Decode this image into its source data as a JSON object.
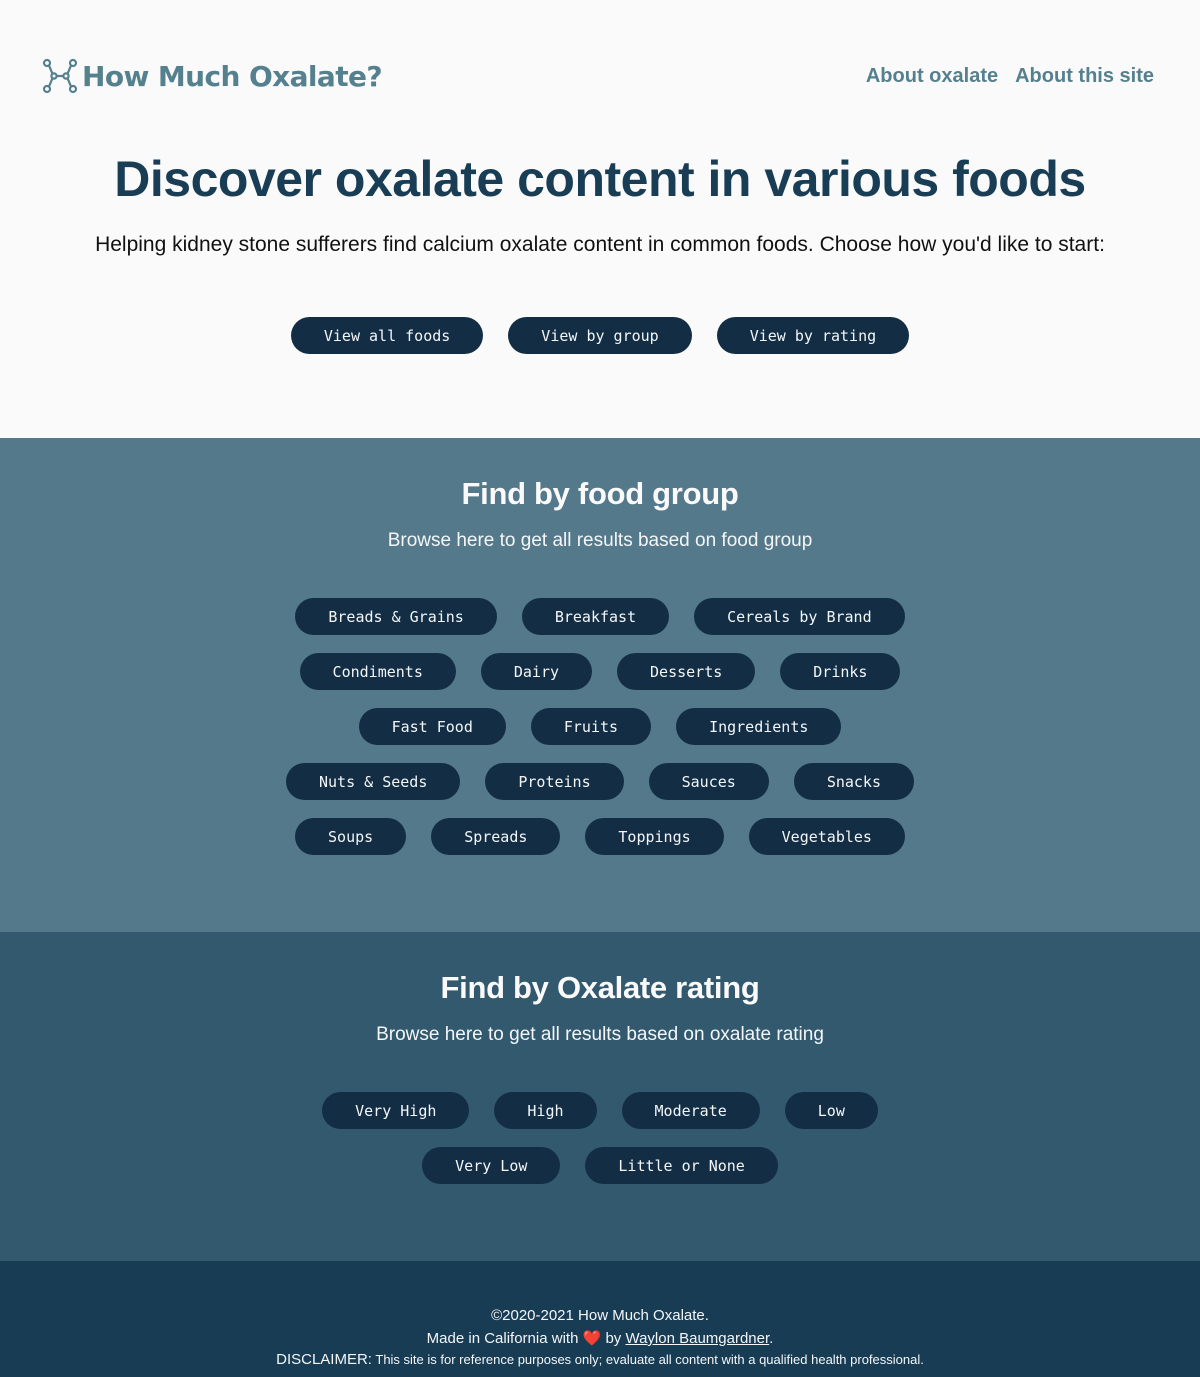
{
  "header": {
    "brand_name": "How Much Oxalate?",
    "brand_icon": "molecule-icon",
    "nav": [
      {
        "label": "About oxalate"
      },
      {
        "label": "About this site"
      }
    ]
  },
  "hero": {
    "title": "Discover oxalate content in various foods",
    "subtitle": "Helping kidney stone sufferers find calcium oxalate content in common foods. Choose how you'd like to start:",
    "buttons": [
      {
        "label": "View all foods"
      },
      {
        "label": "View by group"
      },
      {
        "label": "View by rating"
      }
    ]
  },
  "food_groups": {
    "title": "Find by food group",
    "subtitle": "Browse here to get all results based on food group",
    "rows": [
      [
        "Breads & Grains",
        "Breakfast",
        "Cereals by Brand"
      ],
      [
        "Condiments",
        "Dairy",
        "Desserts",
        "Drinks"
      ],
      [
        "Fast Food",
        "Fruits",
        "Ingredients"
      ],
      [
        "Nuts & Seeds",
        "Proteins",
        "Sauces",
        "Snacks"
      ],
      [
        "Soups",
        "Spreads",
        "Toppings",
        "Vegetables"
      ]
    ]
  },
  "ratings": {
    "title": "Find by Oxalate rating",
    "subtitle": "Browse here to get all results based on oxalate rating",
    "rows": [
      [
        "Very High",
        "High",
        "Moderate",
        "Low"
      ],
      [
        "Very Low",
        "Little or None"
      ]
    ]
  },
  "footer": {
    "copyright": "©2020-2021 How Much Oxalate.",
    "made_in_prefix": "Made in California with",
    "heart": "❤️",
    "made_by": "by",
    "author": "Waylon Baumgardner",
    "period": ".",
    "disclaimer_label": "DISCLAIMER:",
    "disclaimer_text": "This site is for reference purposes only; evaluate all content with a qualified health professional."
  },
  "colors": {
    "brand": "#55808e",
    "heading": "#183d55",
    "pill_bg": "#132e44",
    "group_section_bg": "#53798a",
    "rating_section_bg": "#33596e",
    "footer_bg": "#173c54"
  }
}
